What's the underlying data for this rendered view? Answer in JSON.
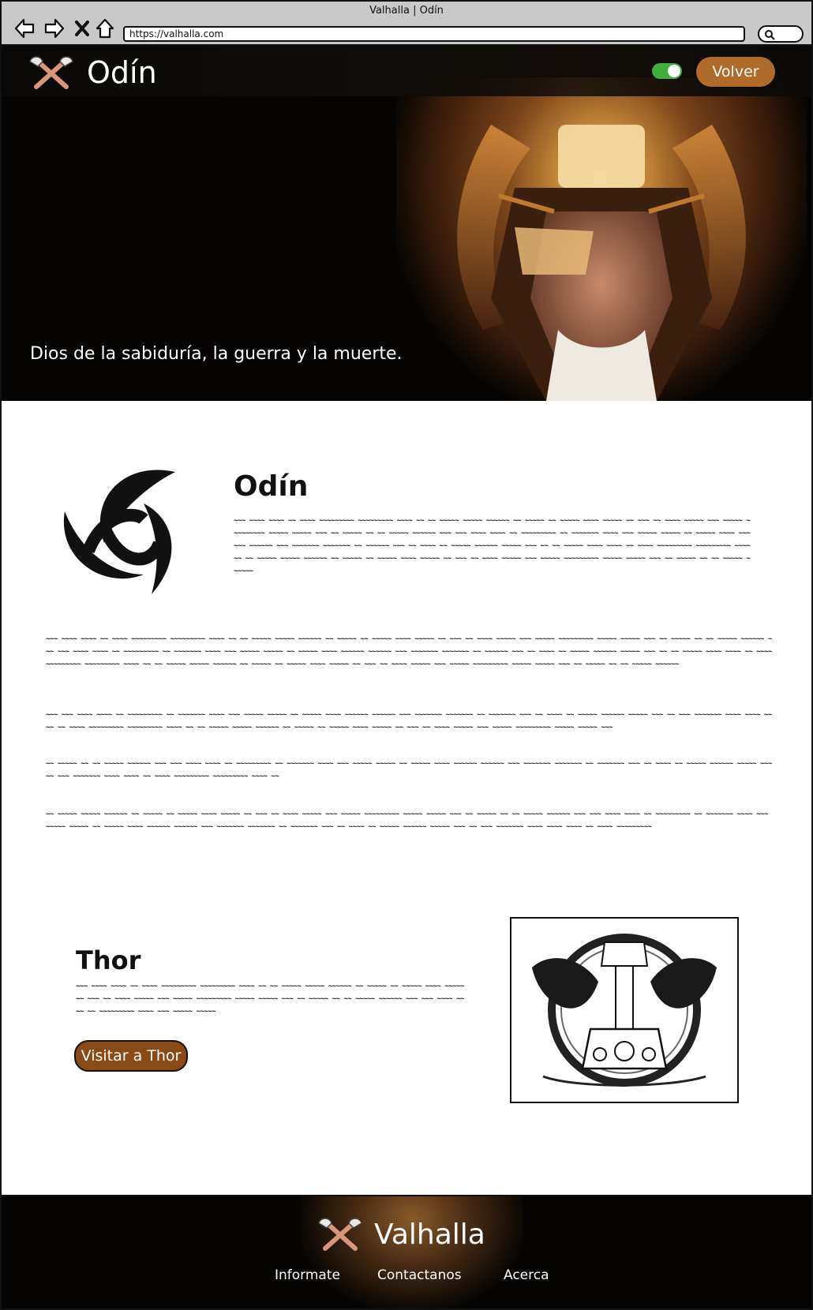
{
  "window": {
    "title": "Valhalla | Odín"
  },
  "browser": {
    "url": "https://valhalla.com"
  },
  "header": {
    "title": "Odín",
    "toggle_on": true,
    "back_label": "Volver"
  },
  "hero": {
    "tagline": "Dios de la sabiduría, la guerra y la muerte."
  },
  "main": {
    "title": "Odín",
    "intro_text": "~~~ ~~~~ ~~~~ ~~ ~~~~ ~~~~~~~~~ ~~~~~~~~~ ~~~~ ~~ ~~ ~~~~~ ~~~~~ ~~~~~~ ~~ ~~~~~ ~~ ~~~~~ ~~~~ ~~~~~ ~~ ~~~ ~~ ~~~~ ~~~~~ ~~~ ~~~~~ ~~~~~~~~~ ~~~~~ ~~~~~ ~~~ ~~ ~~~~~ ~~ ~~ ~~~~~ ~~~~~~ ~~~ ~~~ ~~~~ ~~~~ ~~ ~~~~~~~~~ ~~ ~~~~~~~ ~~~~ ~~~ ~~~~~ ~~~~~ ~~ ~~~~~ ~~~~ ~~~~~~ ~~~~~~ ~~~ ~~~~~~~ ~~~~~~~ ~~ ~~~~~~ ~~~ ~~ ~~~~ ~~ ~~~~~ ~~~~~~ ~~~~~ ~~~ ~~ ~~ ~~~~~ ~~~~ ~~~~ ~~ ~~~~ ~~~~~~~~~ ~~~~~~~~~ ~~~~ ~~ ~~ ~~~~~ ~~~~~ ~~~~~~ ~~ ~~~~~ ~~ ~~~~~ ~~~~ ~~~~~ ~~ ~~~ ~~ ~~~~ ~~~~~ ~~~ ~~~~~ ~~~~~~~~~ ~~~~~ ~~~~~ ~~~ ~~ ~~~~~ ~~ ~~ ~~~~~ ~~~~~~",
    "paragraphs": [
      "~~~ ~~~~ ~~~~ ~~ ~~~~ ~~~~~~~~~ ~~~~~~~~~ ~~~~ ~~ ~~ ~~~~~ ~~~~~ ~~~~~~ ~~ ~~~~~ ~~ ~~~~~ ~~~~ ~~~~~ ~~ ~~~ ~~ ~~~~ ~~~~~ ~~~ ~~~~~ ~~~~~~~~~ ~~~~~ ~~~~~ ~~~ ~~ ~~~~~ ~~ ~~ ~~~~~ ~~~~~~ ~~~ ~~~ ~~~~ ~~~~ ~~ ~~~~~~~~~ ~~ ~~~~~~~ ~~~~ ~~~ ~~~~~ ~~~~~ ~~ ~~~~~ ~~~~ ~~~~~~ ~~~~~~ ~~~ ~~~~~~~ ~~~~~~~ ~~ ~~~~~~ ~~~ ~~ ~~~~ ~~ ~~~~~ ~~~~~~ ~~~~~ ~~~ ~~ ~~ ~~~~~ ~~~~ ~~~~ ~~ ~~~~ ~~~~~~~~~ ~~~~~~~~~ ~~~~ ~~ ~~ ~~~~~ ~~~~~ ~~~~~~ ~~ ~~~~~ ~~ ~~~~~ ~~~~ ~~~~~ ~~ ~~~ ~~ ~~~~ ~~~~~ ~~~ ~~~~~ ~~~~~~~~~ ~~~~~ ~~~~~ ~~~ ~~ ~~~~~ ~~ ~~ ~~~~~ ~~~~~~",
      "~~~ ~~~ ~~~~ ~~~~ ~~ ~~~~~~~~~ ~~ ~~~~~~~ ~~~~ ~~~ ~~~~~ ~~~~~ ~~ ~~~~~ ~~~~ ~~~~~~ ~~~~~~ ~~~ ~~~~~~~ ~~~~~~~ ~~ ~~~~~~~ ~~~ ~~ ~~~~ ~~ ~~~~~ ~~~~~~ ~~~~~ ~~~ ~~ ~~~ ~~~~~~~ ~~~~ ~~~~ ~~~~ ~~ ~~~~ ~~~~~~~~~ ~~~~~~~~~ ~~~~ ~~ ~~ ~~~~~ ~~~~~ ~~~~~~ ~~ ~~~~~ ~~ ~~~~~ ~~~~ ~~~~~ ~~ ~~~ ~~ ~~~~ ~~~~~ ~~~ ~~~~~ ~~~~~~~~~ ~~~~~ ~~~~~ ~~~",
      "~~ ~~~~~ ~~ ~~ ~~~~~ ~~~~~~ ~~~ ~~~ ~~~~ ~~~~ ~~ ~~~~~~~~~ ~~ ~~~~~~~ ~~~~ ~~~ ~~~~~ ~~~~~ ~~ ~~~~~ ~~~~ ~~~~~~ ~~~~~~ ~~~ ~~~~~~~ ~~~~~~~ ~~ ~~~~~~~ ~~~ ~~ ~~~~ ~~ ~~~~~ ~~~~~~ ~~~~~ ~~~ ~~ ~~~ ~~~~~~~ ~~~~ ~~~~ ~~ ~~~~ ~~~~~~~~~ ~~~~~~~~~ ~~~~ ~~",
      "~~ ~~~~~ ~~~~~ ~~~~~~ ~~ ~~~~~ ~~ ~~~~~ ~~~~ ~~~~~ ~~ ~~~ ~~ ~~~~ ~~~~~ ~~~ ~~~~~ ~~~~~~~~~ ~~~~~ ~~~~~ ~~~ ~~ ~~~~~ ~~ ~~ ~~~~~ ~~~~~~ ~~~ ~~~ ~~~~ ~~~~ ~~ ~~~~~~~~~ ~~ ~~~~~~~ ~~~~ ~~~ ~~~~~ ~~~~~ ~~ ~~~~~ ~~~~ ~~~~~~ ~~~~~~ ~~~ ~~~~~~~ ~~~~~~~ ~~ ~~~~~~~ ~~~ ~~ ~~~~ ~~ ~~~~~ ~~~~~~ ~~~~~ ~~~ ~~ ~~~ ~~~~~~~ ~~~~ ~~~~ ~~~~ ~~ ~~~~ ~~~~~~~~~"
    ]
  },
  "feature": {
    "title": "Thor",
    "text": "~~~ ~~~~ ~~~~ ~~ ~~~~ ~~~~~~~~~ ~~~~~~~~~ ~~~~ ~~ ~~ ~~~~~ ~~~~~ ~~~~~~ ~~ ~~~~~ ~~ ~~~~~ ~~~~ ~~~~~ ~~ ~~~ ~~ ~~~~ ~~~~~ ~~~ ~~~~~ ~~~~~~~~~ ~~~~~ ~~~~~ ~~~ ~~ ~~~~~ ~~ ~~ ~~~~~ ~~~~~~ ~~~ ~~~ ~~~~ ~~~~ ~~ ~~~~~~~~~ ~~~~ ~~~ ~~~~~ ~~~~~",
    "button_label": "Visitar a Thor"
  },
  "footer": {
    "brand": "Valhalla",
    "links": [
      "Informate",
      "Contactanos",
      "Acerca"
    ]
  },
  "colors": {
    "accent_button": "#b06a2a",
    "thor_button": "#8a4a16",
    "toggle_on": "#3fae3a",
    "dark_bg": "#050403"
  },
  "icons": [
    "back-arrow-icon",
    "forward-arrow-icon",
    "close-icon",
    "home-icon",
    "search-icon",
    "crossed-axes-icon",
    "triquetra-icon",
    "mjolnir-ravens-image",
    "odin-helmet-image"
  ]
}
